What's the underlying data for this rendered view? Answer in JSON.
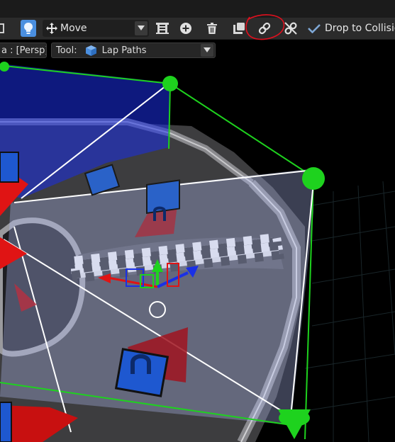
{
  "toolbar": {
    "transform_mode": "Move",
    "drop_to_collision": "Drop to Collision",
    "icons": [
      "scene-icon",
      "lightbulb-icon",
      "move-icon",
      "chevron-down-icon",
      "path-icon",
      "add-icon",
      "delete-icon",
      "duplicate-icon",
      "link-icon",
      "unlink-icon",
      "check-icon"
    ]
  },
  "viewport": {
    "camera_label": "a : [Persp]",
    "tool_label": "Tool:",
    "tool_value": "Lap Paths",
    "tool_icon": "cube-icon"
  },
  "colors": {
    "toolbar_bg": "#2b2b2b",
    "accent": "#4a8fe0",
    "annotation": "#e0101e",
    "selection_green": "#1ed21e",
    "path_red": "#c81010",
    "path_blue": "#1a30e6"
  }
}
